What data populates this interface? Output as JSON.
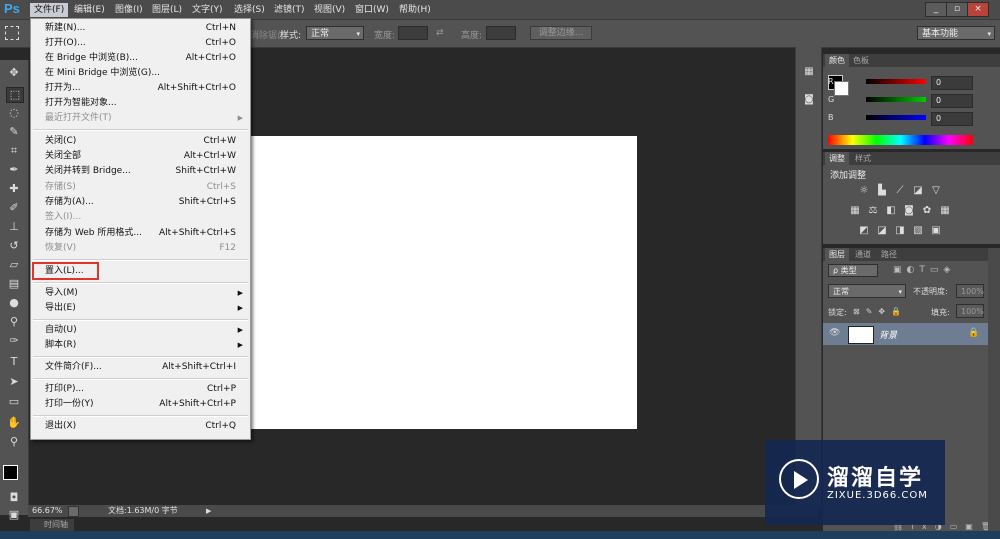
{
  "app": {
    "logo": "Ps"
  },
  "menubar": {
    "items": [
      "文件(F)",
      "编辑(E)",
      "图像(I)",
      "图层(L)",
      "文字(Y)",
      "选择(S)",
      "滤镜(T)",
      "视图(V)",
      "窗口(W)",
      "帮助(H)"
    ],
    "window_controls": [
      "_",
      "▫",
      "×"
    ]
  },
  "options": {
    "feather_hint": "消除锯齿",
    "style_label": "样式:",
    "style_value": "正常",
    "width_label": "宽度:",
    "height_label": "高度:",
    "refine_edge_label": "调整边缘...",
    "workspace": "基本功能"
  },
  "file_menu": {
    "items": [
      {
        "label": "新建(N)...",
        "shortcut": "Ctrl+N"
      },
      {
        "label": "打开(O)...",
        "shortcut": "Ctrl+O"
      },
      {
        "label": "在 Bridge 中浏览(B)...",
        "shortcut": "Alt+Ctrl+O"
      },
      {
        "label": "在 Mini Bridge 中浏览(G)...",
        "shortcut": ""
      },
      {
        "label": "打开为...",
        "shortcut": "Alt+Shift+Ctrl+O"
      },
      {
        "label": "打开为智能对象...",
        "shortcut": ""
      },
      {
        "label": "最近打开文件(T)",
        "shortcut": ""
      },
      {
        "label": "关闭(C)",
        "shortcut": "Ctrl+W"
      },
      {
        "label": "关闭全部",
        "shortcut": "Alt+Ctrl+W"
      },
      {
        "label": "关闭并转到 Bridge...",
        "shortcut": "Shift+Ctrl+W"
      },
      {
        "label": "存储(S)",
        "shortcut": "Ctrl+S"
      },
      {
        "label": "存储为(A)...",
        "shortcut": "Shift+Ctrl+S"
      },
      {
        "label": "签入(I)...",
        "shortcut": ""
      },
      {
        "label": "存储为 Web 所用格式...",
        "shortcut": "Alt+Shift+Ctrl+S"
      },
      {
        "label": "恢复(V)",
        "shortcut": "F12"
      },
      {
        "label": "置入(L)...",
        "shortcut": ""
      },
      {
        "label": "导入(M)",
        "shortcut": ""
      },
      {
        "label": "导出(E)",
        "shortcut": ""
      },
      {
        "label": "自动(U)",
        "shortcut": ""
      },
      {
        "label": "脚本(R)",
        "shortcut": ""
      },
      {
        "label": "文件简介(F)...",
        "shortcut": "Alt+Shift+Ctrl+I"
      },
      {
        "label": "打印(P)...",
        "shortcut": "Ctrl+P"
      },
      {
        "label": "打印一份(Y)",
        "shortcut": "Alt+Shift+Ctrl+P"
      },
      {
        "label": "退出(X)",
        "shortcut": "Ctrl+Q"
      }
    ]
  },
  "status": {
    "zoom": "66.67%",
    "doc_info": "文档:1.63M/0 字节",
    "timeline_tab": "时间轴"
  },
  "color_panel": {
    "tabs": [
      "颜色",
      "色板"
    ],
    "channels": [
      {
        "label": "R",
        "value": "0"
      },
      {
        "label": "G",
        "value": "0"
      },
      {
        "label": "B",
        "value": "0"
      }
    ]
  },
  "adjust_panel": {
    "tabs": [
      "调整",
      "样式"
    ],
    "title": "添加调整"
  },
  "layers_panel": {
    "tabs": [
      "图层",
      "通道",
      "路径"
    ],
    "filter_label": "ρ 类型",
    "blend_mode": "正常",
    "opacity_label": "不透明度:",
    "opacity_value": "100%",
    "lock_label": "锁定:",
    "fill_label": "填充:",
    "fill_value": "100%",
    "layer_name": "背景"
  },
  "watermark": {
    "title": "溜溜自学",
    "url": "ZIXUE.3D66.COM"
  },
  "colors": {
    "menu_bg": "#f0f0f0",
    "highlight": "#e0342c",
    "ps_blue": "#3fa7f0"
  }
}
